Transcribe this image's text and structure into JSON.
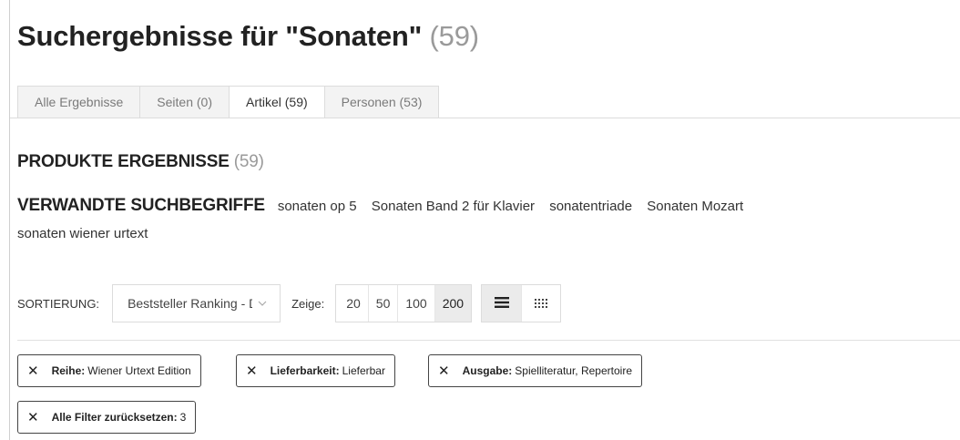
{
  "header": {
    "title": "Suchergebnisse für \"Sonaten\"",
    "count": "(59)"
  },
  "tabs": [
    {
      "label": "Alle Ergebnisse",
      "active": false
    },
    {
      "label": "Seiten (0)",
      "active": false
    },
    {
      "label": "Artikel (59)",
      "active": true
    },
    {
      "label": "Personen (53)",
      "active": false
    }
  ],
  "products": {
    "title": "PRODUKTE ERGEBNISSE",
    "count": "(59)"
  },
  "related": {
    "label": "VERWANDTE SUCHBEGRIFFE",
    "terms": [
      "sonaten op 5",
      "Sonaten Band 2 für Klavier",
      "sonatentriade",
      "Sonaten Mozart",
      "sonaten wiener urtext"
    ]
  },
  "toolbar": {
    "sort_label": "SORTIERUNG:",
    "sort_value": "Beststeller Ranking - Des",
    "show_label": "Zeige:",
    "page_sizes": [
      "20",
      "50",
      "100",
      "200"
    ],
    "active_page_size": "200",
    "views": [
      {
        "icon": "list-view-icon",
        "active": true
      },
      {
        "icon": "grid-view-icon",
        "active": false
      }
    ]
  },
  "filters": [
    {
      "key": "Reihe:",
      "value": "Wiener Urtext Edition"
    },
    {
      "key": "Lieferbarkeit:",
      "value": "Lieferbar"
    },
    {
      "key": "Ausgabe:",
      "value": "Spielliteratur, Repertoire"
    },
    {
      "key": "Alle Filter zurücksetzen:",
      "value": "3"
    }
  ],
  "icons": {
    "remove": "close-icon",
    "dropdown": "chevron-down-icon"
  },
  "colors": {
    "text": "#222222",
    "muted": "#9a9a9a",
    "active_bg": "#ebebeb",
    "border": "#dcdcdc"
  }
}
